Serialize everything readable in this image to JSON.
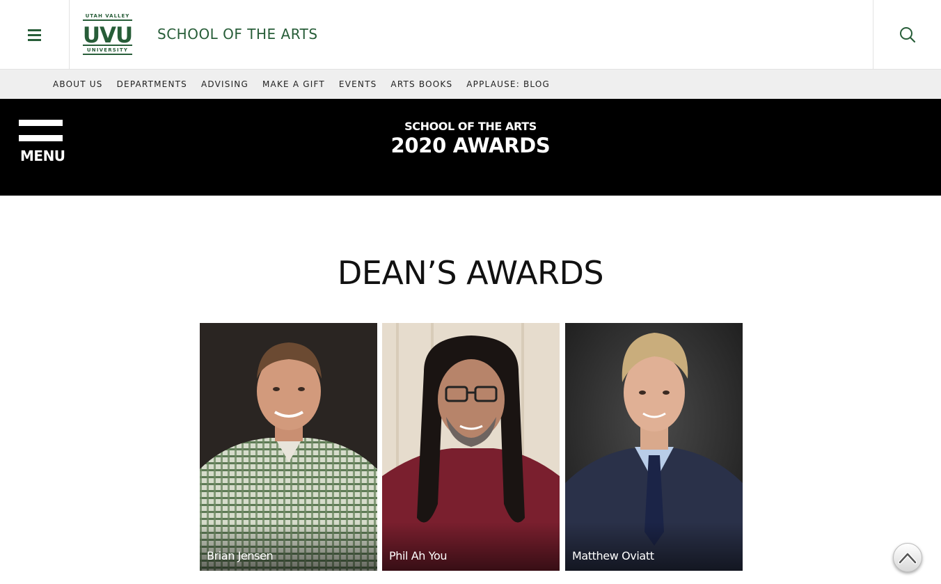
{
  "header": {
    "menu_icon": "hamburger-icon",
    "logo": {
      "top_text": "UTAH VALLEY",
      "mark": "UVU",
      "bottom_text": "UNIVERSITY",
      "color": "#275d38"
    },
    "site_title": "SCHOOL OF THE ARTS",
    "search_icon": "search-icon",
    "brand_color": "#275d38"
  },
  "subnav": {
    "items": [
      {
        "label": "ABOUT US"
      },
      {
        "label": "DEPARTMENTS"
      },
      {
        "label": "ADVISING"
      },
      {
        "label": "MAKE A GIFT"
      },
      {
        "label": "EVENTS"
      },
      {
        "label": "ARTS BOOKS"
      },
      {
        "label": "APPLAUSE: BLOG"
      }
    ]
  },
  "hero": {
    "menu_label": "MENU",
    "eyebrow": "SCHOOL OF THE ARTS",
    "title": "2020 AWARDS"
  },
  "section": {
    "heading": "DEAN’S AWARDS",
    "awardees": [
      {
        "name": "Brian Jensen"
      },
      {
        "name": "Phil Ah You"
      },
      {
        "name": "Matthew Oviatt"
      }
    ]
  },
  "scroll_top_icon": "chevron-up-icon"
}
